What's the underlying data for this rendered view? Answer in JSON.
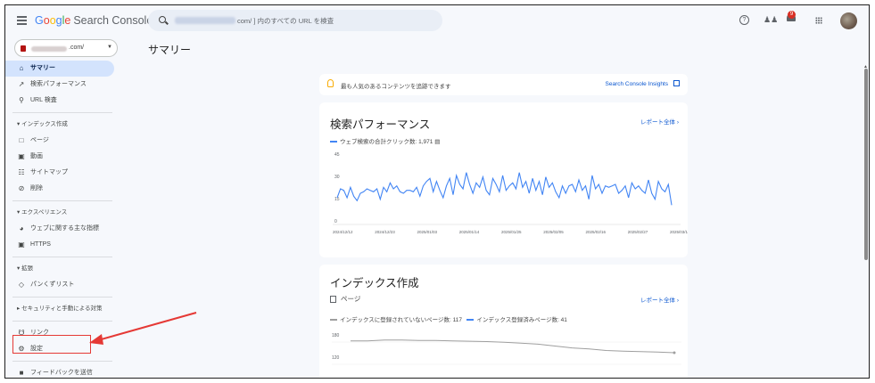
{
  "header": {
    "brand": [
      "G",
      "o",
      "o",
      "g",
      "l",
      "e"
    ],
    "brand_rest": "Search Console",
    "search_text": "com/ ] 内のすべての URL を検査",
    "notification_count": "9"
  },
  "property": {
    "suffix": ".com/"
  },
  "page_title": "サマリー",
  "sidebar": {
    "items_top": [
      {
        "label": "サマリー",
        "icon": "home-icon"
      },
      {
        "label": "検索パフォーマンス",
        "icon": "trending-icon"
      },
      {
        "label": "URL 検査",
        "icon": "search-icon"
      }
    ],
    "section_index": "インデックス作成",
    "items_index": [
      {
        "label": "ページ",
        "icon": "page-icon"
      },
      {
        "label": "動画",
        "icon": "video-icon"
      },
      {
        "label": "サイトマップ",
        "icon": "sitemap-icon"
      },
      {
        "label": "削除",
        "icon": "remove-icon"
      }
    ],
    "section_experience": "エクスペリエンス",
    "items_experience": [
      {
        "label": "ウェブに関する主な指標",
        "icon": "gauge-icon"
      },
      {
        "label": "HTTPS",
        "icon": "lock-icon"
      }
    ],
    "section_enhance": "拡張",
    "items_enhance": [
      {
        "label": "パンくずリスト",
        "icon": "breadcrumb-icon"
      }
    ],
    "section_security": "セキュリティと手動による対策",
    "items_bottom": [
      {
        "label": "リンク",
        "icon": "links-icon"
      },
      {
        "label": "設定",
        "icon": "gear-icon"
      }
    ],
    "feedback": "フィードバックを送信"
  },
  "insights": {
    "text": "最も人気のあるコンテンツを追跡できます",
    "link": "Search Console Insights"
  },
  "performance": {
    "title": "検索パフォーマンス",
    "report_link": "レポート全体",
    "legend": "ウェブ検索の合計クリック数: 1,971",
    "colors": {
      "line": "#4285f4",
      "grid": "#e0e0e0"
    }
  },
  "index_card": {
    "title": "インデックス作成",
    "page_label": "ページ",
    "report_link": "レポート全体",
    "legend_not_indexed": "インデックスに登録されていないページ数: 117",
    "legend_indexed": "インデックス登録済みページ数: 41",
    "colors": {
      "not_indexed": "#9e9e9e",
      "indexed": "#4285f4"
    }
  },
  "chart_data": [
    {
      "type": "line",
      "title": "検索パフォーマンス",
      "series": [
        {
          "name": "ウェブ検索の合計クリック数: 1,971",
          "values": [
            18,
            24,
            23,
            18,
            25,
            19,
            16,
            21,
            22,
            24,
            23,
            22,
            24,
            17,
            25,
            22,
            28,
            24,
            26,
            22,
            21,
            23,
            23,
            22,
            25,
            19,
            26,
            29,
            31,
            22,
            29,
            23,
            18,
            26,
            31,
            20,
            33,
            27,
            24,
            35,
            27,
            21,
            28,
            25,
            32,
            23,
            20,
            31,
            27,
            22,
            33,
            23,
            26,
            28,
            24,
            35,
            25,
            29,
            21,
            31,
            23,
            29,
            20,
            32,
            25,
            28,
            22,
            18,
            26,
            21,
            26,
            27,
            22,
            30,
            23,
            26,
            17,
            33,
            24,
            27,
            21,
            26,
            25,
            26,
            27,
            21,
            23,
            26,
            18,
            28,
            24,
            26,
            23,
            21,
            30,
            21,
            17,
            29,
            24,
            22,
            27,
            13
          ]
        }
      ],
      "yticks": [
        "0",
        "15",
        "30",
        "45"
      ],
      "ylim": [
        0,
        45
      ],
      "xtick_labels": [
        "2024/12/12",
        "2024/12/23",
        "2025/01/03",
        "2025/01/14",
        "2025/01/25",
        "2025/02/05",
        "2025/02/16",
        "2025/02/27",
        "2025/03/10"
      ]
    },
    {
      "type": "line",
      "title": "インデックス作成",
      "series": [
        {
          "name": "インデックスに登録されていないページ数: 117",
          "values": [
            164,
            164,
            166,
            166,
            165,
            165,
            164,
            163,
            162,
            160,
            158,
            155,
            150,
            145,
            142,
            138,
            136,
            135,
            134,
            132
          ]
        }
      ],
      "yticks": [
        "180",
        "120"
      ],
      "ylim": [
        100,
        190
      ]
    }
  ]
}
